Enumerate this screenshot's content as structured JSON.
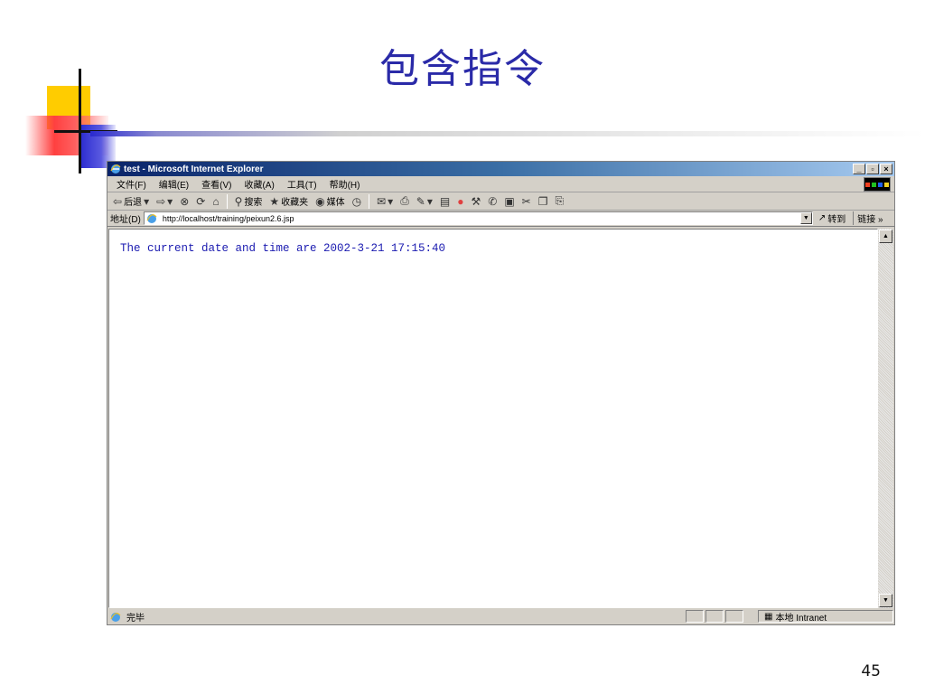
{
  "slide": {
    "title": "包含指令",
    "page_number": "45"
  },
  "browser": {
    "window_title": "test - Microsoft Internet Explorer",
    "window_buttons": {
      "minimize": "_",
      "maximize": "▫",
      "close": "×"
    },
    "menu": [
      "文件(F)",
      "编辑(E)",
      "查看(V)",
      "收藏(A)",
      "工具(T)",
      "帮助(H)"
    ],
    "toolbar": {
      "back": "后退",
      "search": "搜索",
      "favorites": "收藏夹",
      "media": "媒体"
    },
    "address": {
      "label": "地址(D)",
      "url": "http://localhost/training/peixun2.6.jsp",
      "go": "转到",
      "links": "链接 »"
    },
    "content": {
      "text": "The current date and time are 2002-3-21 17:15:40"
    },
    "status": {
      "text": "完毕",
      "zone": "本地 Intranet"
    }
  },
  "colors": {
    "title": "#2a2aa8",
    "content_text": "#1a1ab0",
    "titlebar_start": "#0a246a",
    "titlebar_end": "#a6caf0"
  }
}
